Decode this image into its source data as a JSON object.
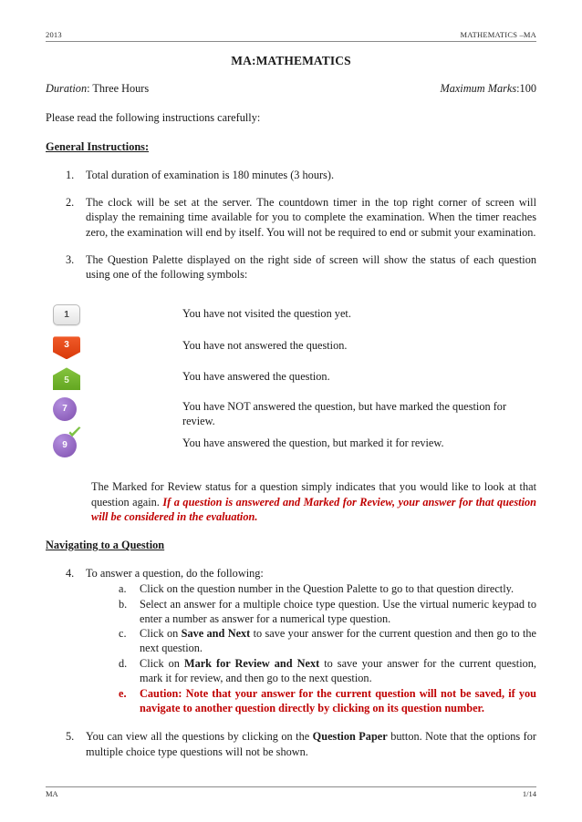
{
  "header": {
    "left": "2013",
    "right": "MATHEMATICS –MA"
  },
  "title": "MA:MATHEMATICS",
  "meta": {
    "duration_label": "Duration",
    "duration_value": ": Three Hours",
    "marks_label": "Maximum Marks",
    "marks_value": ":100"
  },
  "intro": "Please read the following instructions carefully:",
  "general_heading": "General Instructions:",
  "instructions": [
    {
      "marker": "1.",
      "text": "Total duration of examination is 180 minutes (3 hours)."
    },
    {
      "marker": "2.",
      "text": "The clock will be set at the server.  The countdown timer in the top right corner of screen will display the remaining time available for you to complete the examination. When the timer reaches zero, the examination will end by itself. You will not be required to end or submit your examination."
    },
    {
      "marker": "3.",
      "text": "The Question Palette displayed on the right side of screen will show the status of each question using one of the following symbols:"
    }
  ],
  "legend": [
    {
      "icon": "not-visited-icon",
      "number": "1",
      "text": "You have not visited the question yet."
    },
    {
      "icon": "not-answered-icon",
      "number": "3",
      "text": "You have not answered the question."
    },
    {
      "icon": "answered-icon",
      "number": "5",
      "text": "You have answered the question."
    },
    {
      "icon": "marked-for-review-icon",
      "number": "7",
      "text": "You have NOT answered the question, but have marked the question for review."
    },
    {
      "icon": "answered-and-marked-icon",
      "number": "9",
      "text": "You have answered the question, but marked it for review.",
      "tick": "✔"
    }
  ],
  "review_note": {
    "plain": "The Marked for Review status for a question simply indicates that you would like to look at that question again. ",
    "emphasis": "If a question is answered and  Marked for Review, your answer for that question will be considered in the evaluation."
  },
  "navigating_heading": "Navigating to a Question",
  "navigating": {
    "marker": "4.",
    "lead": "To answer a question, do the following:",
    "steps": [
      {
        "marker": "a.",
        "pre": "Click on the question number in the Question Palette to go to that question directly.",
        "bold": "",
        "post": ""
      },
      {
        "marker": "b.",
        "pre": "Select an answer for a multiple choice type question. Use the virtual numeric keypad to enter a number as answer for a numerical type question.",
        "bold": "",
        "post": ""
      },
      {
        "marker": "c.",
        "pre": "Click on ",
        "bold": "Save and Next",
        "post": " to save your answer for the current question and then go to the next question."
      },
      {
        "marker": "d.",
        "pre": "Click on ",
        "bold": "Mark for Review and Next",
        "post": " to save your answer for the  current question, mark it for review, and then go to the next question."
      },
      {
        "marker": "e.",
        "caution": "Caution: Note that your answer for the current question will not be saved, if you navigate to another question directly by clicking on its question number."
      }
    ]
  },
  "item5": {
    "marker": "5.",
    "pre": "You can view all the questions by clicking on the ",
    "bold": "Question Paper",
    "post": " button. Note that the options for multiple choice type questions will not be shown."
  },
  "footer": {
    "left": "MA",
    "right": "1/14"
  },
  "colors": {
    "not_visited": "#e3e3e3",
    "not_answered": "#d93a0b",
    "answered": "#63a721",
    "marked": "#8f62bd",
    "caution_red": "#c00000"
  }
}
